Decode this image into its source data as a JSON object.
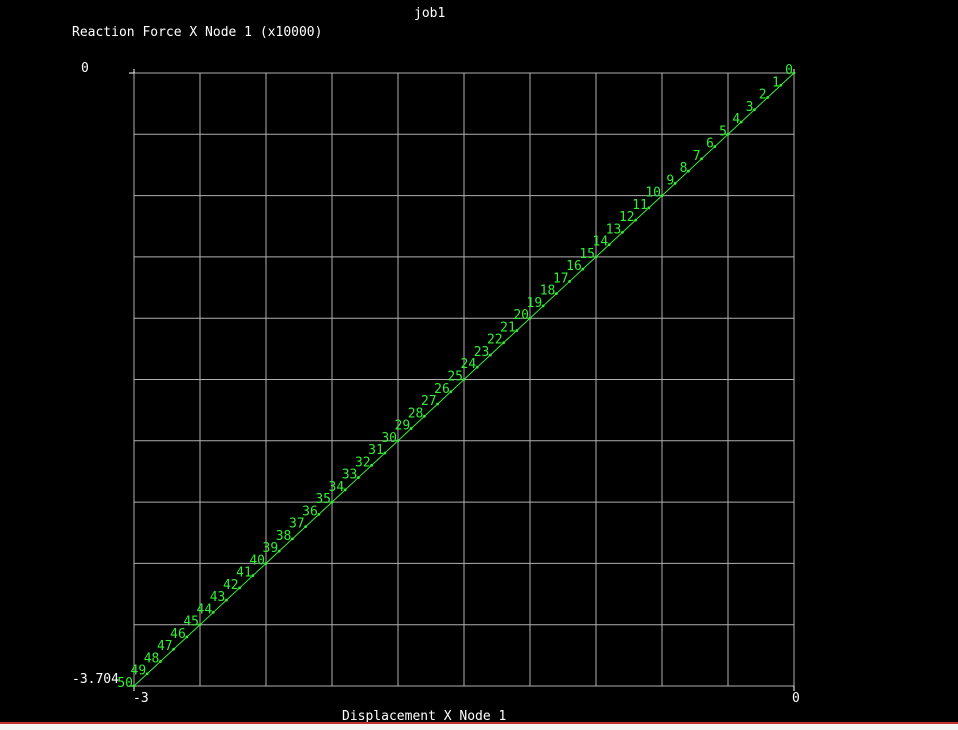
{
  "window": {
    "title": "job1"
  },
  "colors": {
    "background": "#000000",
    "grid": "#b0b0b0",
    "series": "#33ee33",
    "text": "#ffffff",
    "border_bottom": "#c03030"
  },
  "chart_data": {
    "type": "line",
    "title": "job1",
    "ylabel": "Reaction Force X Node 1 (x10000)",
    "xlabel": "Displacement X Node 1",
    "xlim": [
      -3,
      0
    ],
    "ylim": [
      -3.704,
      0
    ],
    "x_ticks": [
      "-3",
      "0"
    ],
    "y_ticks": [
      "-3.704",
      "0"
    ],
    "grid": true,
    "grid_divisions": {
      "x": 10,
      "y": 10
    },
    "series": [
      {
        "marker": "increment-number",
        "x": [
          0,
          -0.06,
          -0.12,
          -0.18,
          -0.24,
          -0.3,
          -0.36,
          -0.42,
          -0.48,
          -0.54,
          -0.6,
          -0.66,
          -0.72,
          -0.78,
          -0.84,
          -0.9,
          -0.96,
          -1.02,
          -1.08,
          -1.14,
          -1.2,
          -1.26,
          -1.32,
          -1.38,
          -1.44,
          -1.5,
          -1.56,
          -1.62,
          -1.68,
          -1.74,
          -1.8,
          -1.86,
          -1.92,
          -1.98,
          -2.04,
          -2.1,
          -2.16,
          -2.22,
          -2.28,
          -2.34,
          -2.4,
          -2.46,
          -2.52,
          -2.58,
          -2.64,
          -2.7,
          -2.76,
          -2.82,
          -2.88,
          -2.94,
          -3
        ],
        "y": [
          0,
          -0.0741,
          -0.1482,
          -0.2222,
          -0.2963,
          -0.3704,
          -0.4445,
          -0.5186,
          -0.5926,
          -0.6667,
          -0.7408,
          -0.8149,
          -0.889,
          -0.963,
          -1.0371,
          -1.1112,
          -1.1853,
          -1.2594,
          -1.3334,
          -1.4075,
          -1.4816,
          -1.5557,
          -1.6298,
          -1.7038,
          -1.7779,
          -1.852,
          -1.9261,
          -2.0002,
          -2.0742,
          -2.1483,
          -2.2224,
          -2.2965,
          -2.3706,
          -2.4446,
          -2.5187,
          -2.5928,
          -2.6669,
          -2.741,
          -2.815,
          -2.8891,
          -2.9632,
          -3.0373,
          -3.1114,
          -3.1854,
          -3.2595,
          -3.3336,
          -3.4077,
          -3.4818,
          -3.5558,
          -3.6299,
          -3.704
        ],
        "labels": [
          "0",
          "1",
          "2",
          "3",
          "4",
          "5",
          "6",
          "7",
          "8",
          "9",
          "10",
          "11",
          "12",
          "13",
          "14",
          "15",
          "16",
          "17",
          "18",
          "19",
          "20",
          "21",
          "22",
          "23",
          "24",
          "25",
          "26",
          "27",
          "28",
          "29",
          "30",
          "31",
          "32",
          "33",
          "34",
          "35",
          "36",
          "37",
          "38",
          "39",
          "40",
          "41",
          "42",
          "43",
          "44",
          "45",
          "46",
          "47",
          "48",
          "49",
          "50"
        ]
      }
    ]
  }
}
